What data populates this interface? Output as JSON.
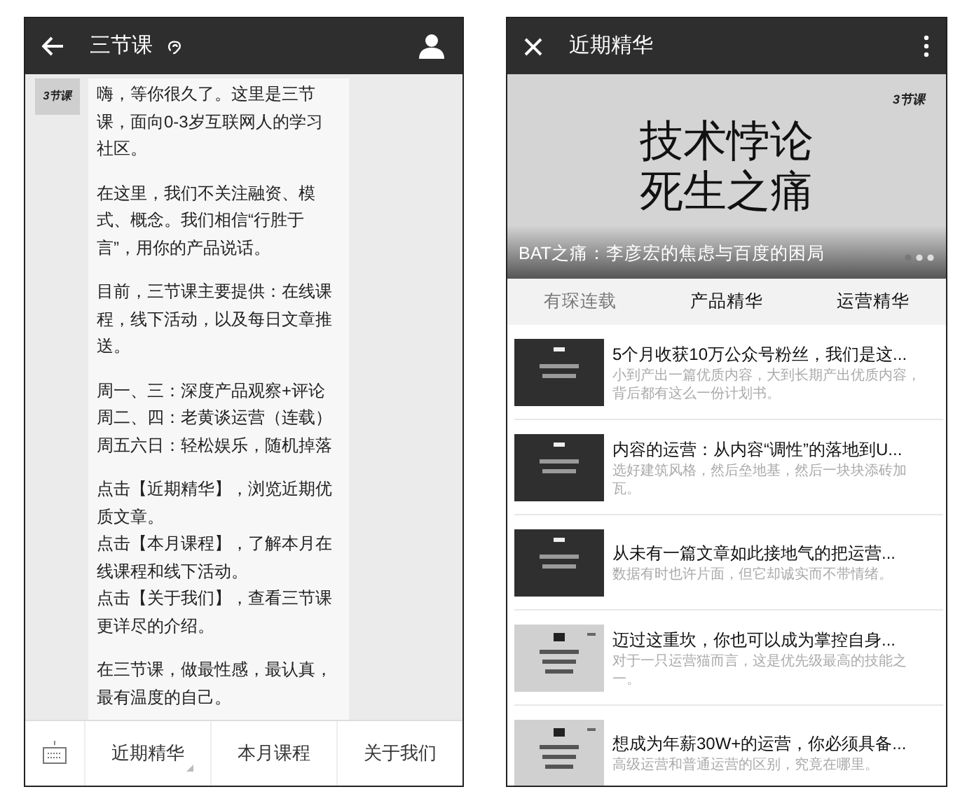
{
  "chat_screen": {
    "title": "三节课",
    "avatar_logo": "3节课",
    "message": [
      [
        "嗨，等你很久了。这里是三节",
        "课，面向0-3岁互联网人的学习",
        "社区。"
      ],
      [
        "在这里，我们不关注融资、模",
        "式、概念。我们相信“行胜于",
        "言”，用你的产品说话。"
      ],
      [
        "目前，三节课主要提供：在线课",
        "程，线下活动，以及每日文章推",
        "送。"
      ],
      [
        "周一、三：深度产品观察+评论",
        "周二、四：老黄谈运营（连载）",
        "周五六日：轻松娱乐，随机掉落"
      ],
      [
        "点击【近期精华】，浏览近期优",
        "质文章。",
        "点击【本月课程】，了解本月在",
        "线课程和线下活动。",
        "点击【关于我们】，查看三节课",
        "更详尽的介绍。"
      ],
      [
        "在三节课，做最性感，最认真，",
        "最有温度的自己。"
      ]
    ],
    "menu": [
      {
        "label": "近期精华",
        "submenu": true
      },
      {
        "label": "本月课程",
        "submenu": false
      },
      {
        "label": "关于我们",
        "submenu": false
      }
    ]
  },
  "article_screen": {
    "title": "近期精华",
    "banner": {
      "logo": "3节课",
      "headline": [
        "技术悖论",
        "死生之痛"
      ],
      "caption": "BAT之痛：李彦宏的焦虑与百度的困局"
    },
    "tabs": [
      {
        "label": "有琛连载",
        "muted": true
      },
      {
        "label": "产品精华",
        "muted": false
      },
      {
        "label": "运营精华",
        "muted": false
      }
    ],
    "articles": [
      {
        "title": "5个月收获10万公众号粉丝，我们是这...",
        "summary": "小到产出一篇优质内容，大到长期产出优质内容，背后都有这么一份计划书。",
        "dark_thumbnail": true
      },
      {
        "title": "内容的运营：从内容“调性”的落地到U...",
        "summary": "选好建筑风格，然后垒地基，然后一块块添砖加瓦。",
        "dark_thumbnail": true
      },
      {
        "title": "从未有一篇文章如此接地气的把运营...",
        "summary": "数据有时也许片面，但它却诚实而不带情绪。",
        "dark_thumbnail": true
      },
      {
        "title": "迈过这重坎，你也可以成为掌控自身...",
        "summary": "对于一只运营猫而言，这是优先级最高的技能之一。",
        "dark_thumbnail": false
      },
      {
        "title": "想成为年薪30W+的运营，你必须具备...",
        "summary": "高级运营和普通运营的区别，究竟在哪里。",
        "dark_thumbnail": false
      }
    ]
  }
}
